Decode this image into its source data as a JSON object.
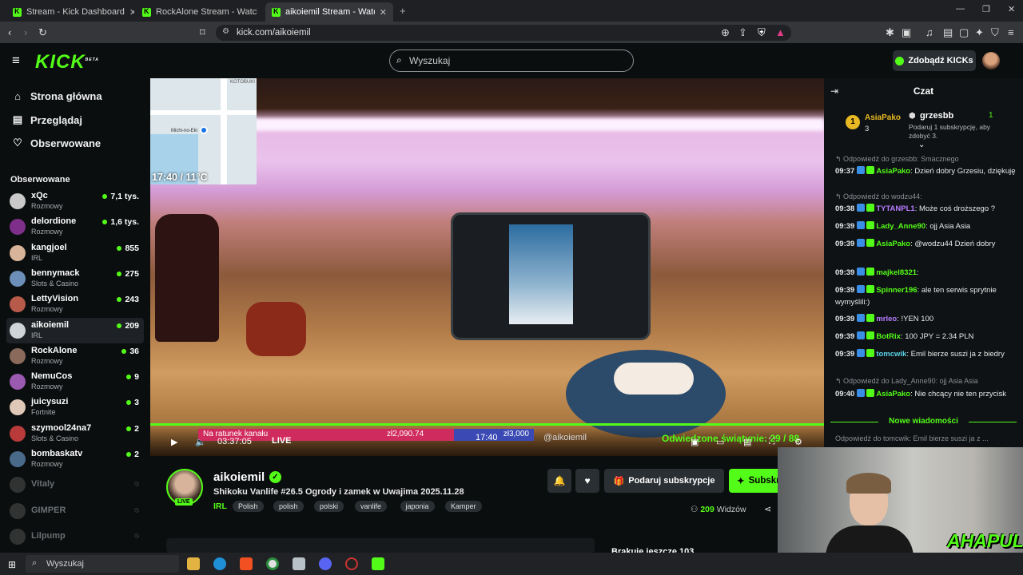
{
  "browser": {
    "tabs": [
      {
        "title": "Stream - Kick Dashboard"
      },
      {
        "title": "RockAlone Stream - Watch Live on Kick"
      },
      {
        "title": "aikoiemil Stream - Watch Live on Kick"
      }
    ],
    "url": "kick.com/aikoiemil"
  },
  "header": {
    "logo": "KICK",
    "logo_sup": "BETA",
    "search_placeholder": "Wyszukaj",
    "kicks_button": "Zdobądź KICKs"
  },
  "sidebar": {
    "nav": [
      {
        "label": "Strona główna",
        "icon": "home-icon"
      },
      {
        "label": "Przeglądaj",
        "icon": "browse-icon"
      },
      {
        "label": "Obserwowane",
        "icon": "heart-icon"
      }
    ],
    "section_title": "Obserwowane",
    "channels": [
      {
        "name": "xQc",
        "category": "Rozmowy",
        "viewers": "7,1 tys.",
        "color": "#c9c9c9"
      },
      {
        "name": "delordione",
        "category": "Rozmowy",
        "viewers": "1,6 tys.",
        "color": "#7d2f8a"
      },
      {
        "name": "kangjoel",
        "category": "IRL",
        "viewers": "855",
        "color": "#d8b49a"
      },
      {
        "name": "bennymack",
        "category": "Slots & Casino",
        "viewers": "275",
        "color": "#6b8fb8"
      },
      {
        "name": "LettyVision",
        "category": "Rozmowy",
        "viewers": "243",
        "color": "#b85a4a"
      },
      {
        "name": "aikoiemil",
        "category": "IRL",
        "viewers": "209",
        "color": "#cfd4d8"
      },
      {
        "name": "RockAlone",
        "category": "Rozmowy",
        "viewers": "36",
        "color": "#8a6a5a"
      },
      {
        "name": "NemuCos",
        "category": "Rozmowy",
        "viewers": "9",
        "color": "#9a5ab0"
      },
      {
        "name": "juicysuzi",
        "category": "Fortnite",
        "viewers": "3",
        "color": "#e0c8b8"
      },
      {
        "name": "szymool24na7",
        "category": "Slots & Casino",
        "viewers": "2",
        "color": "#b83a3a"
      },
      {
        "name": "bombaskatv",
        "category": "Rozmowy",
        "viewers": "2",
        "color": "#4a6a8a"
      }
    ],
    "offline_channels": [
      {
        "name": "Vitaly"
      },
      {
        "name": "GIMPER"
      },
      {
        "name": "Lilpump"
      }
    ]
  },
  "video": {
    "overlay_time_temp": "17:40 / 11°C",
    "map_label": "KOTOBUKI",
    "map_place": "Michi-no-Eki",
    "duration": "03:37:05",
    "live_label": "LIVE",
    "goal_label": "Na ratunek kanału",
    "goal_current": "zł2,090.74",
    "goal_target": "zł3,000",
    "overlay_clock": "17:40",
    "overlay_handle": "@aikoiemil",
    "overlay_green": "Odwiedzone świątynie: 29 / 88"
  },
  "stream": {
    "name": "aikoiemil",
    "live_tag": "LIVE",
    "title": "Shikoku Vanlife #26.5 Ogrody i zamek w Uwajima 2025.11.28",
    "category": "IRL",
    "tags": [
      "Polish",
      "polish",
      "polski",
      "vanlife",
      "japonia",
      "Kamper"
    ],
    "gift_button": "Podaruj subskrypcje",
    "sub_button": "Subskrybuj",
    "viewers_count": "209",
    "viewers_label": "Widzów",
    "below_text": "Brakuje jeszcze 103"
  },
  "chat": {
    "title": "Czat",
    "pinned": {
      "left_user": "AsiaPako",
      "left_count": "3",
      "right_user": "grzesbb",
      "right_count": "1",
      "right_text": "Podaruj 1 subskrypcję, aby zdobyć 3."
    },
    "messages": [
      {
        "reply": "Odpowiedź do grzesbb: Smacznego"
      },
      {
        "time": "09:37",
        "user": "AsiaPako",
        "color": "#53fc18",
        "text": "Dzień dobry Grzesiu, dziękuję"
      },
      {
        "reply": "Odpowiedź do wodzu44:"
      },
      {
        "time": "09:38",
        "user": "TYTANPL1",
        "color": "#b67cff",
        "text": "Może coś droższego ?"
      },
      {
        "time": "09:39",
        "user": "Lady_Anne90",
        "color": "#53fc18",
        "text": "ojj Asia Asia"
      },
      {
        "time": "09:39",
        "user": "AsiaPako",
        "color": "#53fc18",
        "text": "@wodzu44 Dzień dobry"
      },
      {
        "time": "09:39",
        "user": "majkel8321",
        "color": "#53fc18",
        "text": ""
      },
      {
        "time": "09:39",
        "user": "Spinner196",
        "color": "#53fc18",
        "text": "ale ten serwis sprytnie wymyślili:)"
      },
      {
        "time": "09:39",
        "user": "mrleo",
        "color": "#b67cff",
        "text": "!YEN 100"
      },
      {
        "time": "09:39",
        "user": "BotRix",
        "color": "#53fc18",
        "text": "100 JPY = 2.34 PLN"
      },
      {
        "time": "09:39",
        "user": "tomcwik",
        "color": "#5ad1e6",
        "text": "Emil bierze suszi ja z biedry"
      },
      {
        "reply": "Odpowiedź do Lady_Anne90: ojj Asia Asia"
      },
      {
        "time": "09:40",
        "user": "AsiaPako",
        "color": "#53fc18",
        "text": "Nie chcący nie ten przycisk"
      }
    ],
    "new_messages": "Nowe wiadomości",
    "last_reply": "Odpowiedź do tomcwik: Emil bierze suszi ja z ..."
  },
  "webcam": {
    "logo": "AHAPULCO"
  },
  "taskbar": {
    "search": "Wyszukaj"
  }
}
